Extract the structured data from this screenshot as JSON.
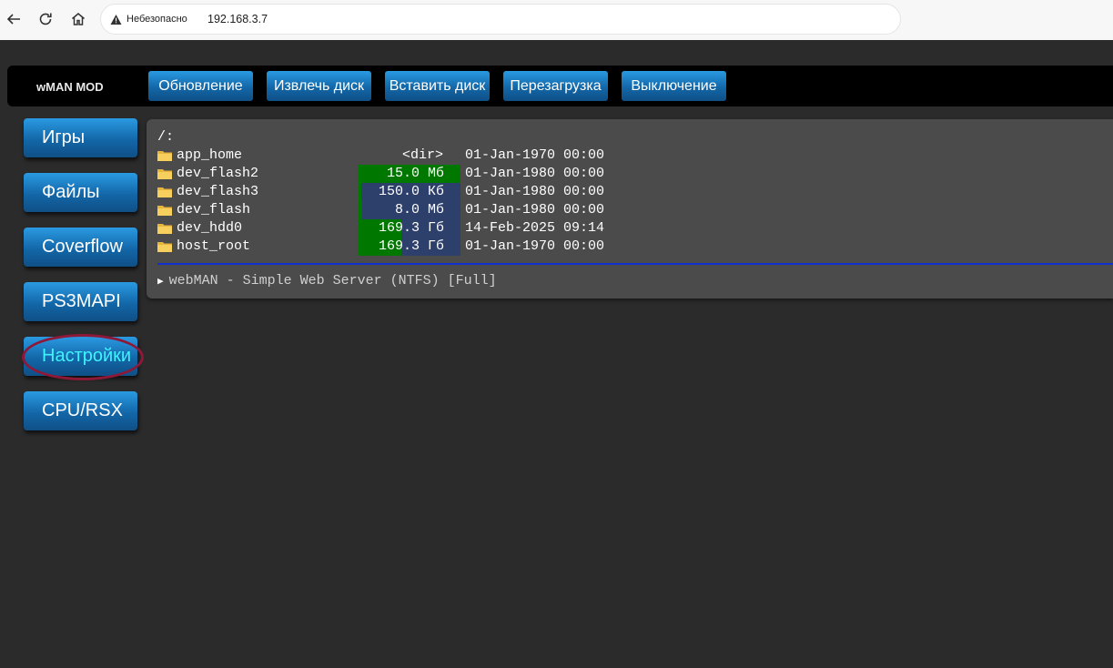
{
  "browser": {
    "security_label": "Небезопасно",
    "url": "192.168.3.7",
    "icons": [
      "back-icon",
      "reload-icon",
      "home-icon",
      "warning-icon"
    ]
  },
  "app": {
    "logo": "wMAN MOD",
    "top_buttons": [
      "Обновление",
      "Извлечь диск",
      "Вставить диск",
      "Перезагрузка",
      "Выключение"
    ],
    "sidebar": [
      "Игры",
      "Файлы",
      "Coverflow",
      "PS3MAPI",
      "Настройки",
      "CPU/RSX"
    ],
    "active_sidebar": "Настройки",
    "accent_color": "#1b7ec6",
    "active_text_color": "#3ff3ff"
  },
  "listing": {
    "path": "/:",
    "entries": [
      {
        "name": "app_home",
        "size": "",
        "dir_label": "<dir>",
        "date": "01-Jan-1970 00:00",
        "usage": 0
      },
      {
        "name": "dev_flash2",
        "size": "15.0 Мб",
        "dir_label": "",
        "date": "01-Jan-1980 00:00",
        "usage": 1.0
      },
      {
        "name": "dev_flash3",
        "size": "150.0 Кб",
        "dir_label": "",
        "date": "01-Jan-1980 00:00",
        "usage": 0.03
      },
      {
        "name": "dev_flash",
        "size": "8.0 Мб",
        "dir_label": "",
        "date": "01-Jan-1980 00:00",
        "usage": 0.04
      },
      {
        "name": "dev_hdd0",
        "size": "169.3 Гб",
        "dir_label": "",
        "date": "14-Feb-2025 09:14",
        "usage": 0.42
      },
      {
        "name": "host_root",
        "size": "169.3 Гб",
        "dir_label": "",
        "date": "01-Jan-1970 00:00",
        "usage": 0.42
      }
    ],
    "footer": "webMAN - Simple Web Server (NTFS) [Full]"
  }
}
